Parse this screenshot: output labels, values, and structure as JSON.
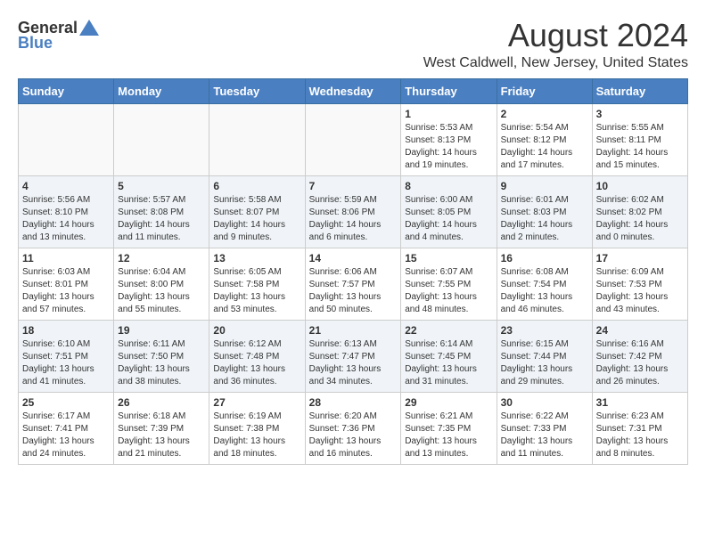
{
  "header": {
    "logo_general": "General",
    "logo_blue": "Blue",
    "title": "August 2024",
    "subtitle": "West Caldwell, New Jersey, United States"
  },
  "days_of_week": [
    "Sunday",
    "Monday",
    "Tuesday",
    "Wednesday",
    "Thursday",
    "Friday",
    "Saturday"
  ],
  "weeks": [
    [
      {
        "day": "",
        "info": ""
      },
      {
        "day": "",
        "info": ""
      },
      {
        "day": "",
        "info": ""
      },
      {
        "day": "",
        "info": ""
      },
      {
        "day": "1",
        "info": "Sunrise: 5:53 AM\nSunset: 8:13 PM\nDaylight: 14 hours\nand 19 minutes."
      },
      {
        "day": "2",
        "info": "Sunrise: 5:54 AM\nSunset: 8:12 PM\nDaylight: 14 hours\nand 17 minutes."
      },
      {
        "day": "3",
        "info": "Sunrise: 5:55 AM\nSunset: 8:11 PM\nDaylight: 14 hours\nand 15 minutes."
      }
    ],
    [
      {
        "day": "4",
        "info": "Sunrise: 5:56 AM\nSunset: 8:10 PM\nDaylight: 14 hours\nand 13 minutes."
      },
      {
        "day": "5",
        "info": "Sunrise: 5:57 AM\nSunset: 8:08 PM\nDaylight: 14 hours\nand 11 minutes."
      },
      {
        "day": "6",
        "info": "Sunrise: 5:58 AM\nSunset: 8:07 PM\nDaylight: 14 hours\nand 9 minutes."
      },
      {
        "day": "7",
        "info": "Sunrise: 5:59 AM\nSunset: 8:06 PM\nDaylight: 14 hours\nand 6 minutes."
      },
      {
        "day": "8",
        "info": "Sunrise: 6:00 AM\nSunset: 8:05 PM\nDaylight: 14 hours\nand 4 minutes."
      },
      {
        "day": "9",
        "info": "Sunrise: 6:01 AM\nSunset: 8:03 PM\nDaylight: 14 hours\nand 2 minutes."
      },
      {
        "day": "10",
        "info": "Sunrise: 6:02 AM\nSunset: 8:02 PM\nDaylight: 14 hours\nand 0 minutes."
      }
    ],
    [
      {
        "day": "11",
        "info": "Sunrise: 6:03 AM\nSunset: 8:01 PM\nDaylight: 13 hours\nand 57 minutes."
      },
      {
        "day": "12",
        "info": "Sunrise: 6:04 AM\nSunset: 8:00 PM\nDaylight: 13 hours\nand 55 minutes."
      },
      {
        "day": "13",
        "info": "Sunrise: 6:05 AM\nSunset: 7:58 PM\nDaylight: 13 hours\nand 53 minutes."
      },
      {
        "day": "14",
        "info": "Sunrise: 6:06 AM\nSunset: 7:57 PM\nDaylight: 13 hours\nand 50 minutes."
      },
      {
        "day": "15",
        "info": "Sunrise: 6:07 AM\nSunset: 7:55 PM\nDaylight: 13 hours\nand 48 minutes."
      },
      {
        "day": "16",
        "info": "Sunrise: 6:08 AM\nSunset: 7:54 PM\nDaylight: 13 hours\nand 46 minutes."
      },
      {
        "day": "17",
        "info": "Sunrise: 6:09 AM\nSunset: 7:53 PM\nDaylight: 13 hours\nand 43 minutes."
      }
    ],
    [
      {
        "day": "18",
        "info": "Sunrise: 6:10 AM\nSunset: 7:51 PM\nDaylight: 13 hours\nand 41 minutes."
      },
      {
        "day": "19",
        "info": "Sunrise: 6:11 AM\nSunset: 7:50 PM\nDaylight: 13 hours\nand 38 minutes."
      },
      {
        "day": "20",
        "info": "Sunrise: 6:12 AM\nSunset: 7:48 PM\nDaylight: 13 hours\nand 36 minutes."
      },
      {
        "day": "21",
        "info": "Sunrise: 6:13 AM\nSunset: 7:47 PM\nDaylight: 13 hours\nand 34 minutes."
      },
      {
        "day": "22",
        "info": "Sunrise: 6:14 AM\nSunset: 7:45 PM\nDaylight: 13 hours\nand 31 minutes."
      },
      {
        "day": "23",
        "info": "Sunrise: 6:15 AM\nSunset: 7:44 PM\nDaylight: 13 hours\nand 29 minutes."
      },
      {
        "day": "24",
        "info": "Sunrise: 6:16 AM\nSunset: 7:42 PM\nDaylight: 13 hours\nand 26 minutes."
      }
    ],
    [
      {
        "day": "25",
        "info": "Sunrise: 6:17 AM\nSunset: 7:41 PM\nDaylight: 13 hours\nand 24 minutes."
      },
      {
        "day": "26",
        "info": "Sunrise: 6:18 AM\nSunset: 7:39 PM\nDaylight: 13 hours\nand 21 minutes."
      },
      {
        "day": "27",
        "info": "Sunrise: 6:19 AM\nSunset: 7:38 PM\nDaylight: 13 hours\nand 18 minutes."
      },
      {
        "day": "28",
        "info": "Sunrise: 6:20 AM\nSunset: 7:36 PM\nDaylight: 13 hours\nand 16 minutes."
      },
      {
        "day": "29",
        "info": "Sunrise: 6:21 AM\nSunset: 7:35 PM\nDaylight: 13 hours\nand 13 minutes."
      },
      {
        "day": "30",
        "info": "Sunrise: 6:22 AM\nSunset: 7:33 PM\nDaylight: 13 hours\nand 11 minutes."
      },
      {
        "day": "31",
        "info": "Sunrise: 6:23 AM\nSunset: 7:31 PM\nDaylight: 13 hours\nand 8 minutes."
      }
    ]
  ]
}
